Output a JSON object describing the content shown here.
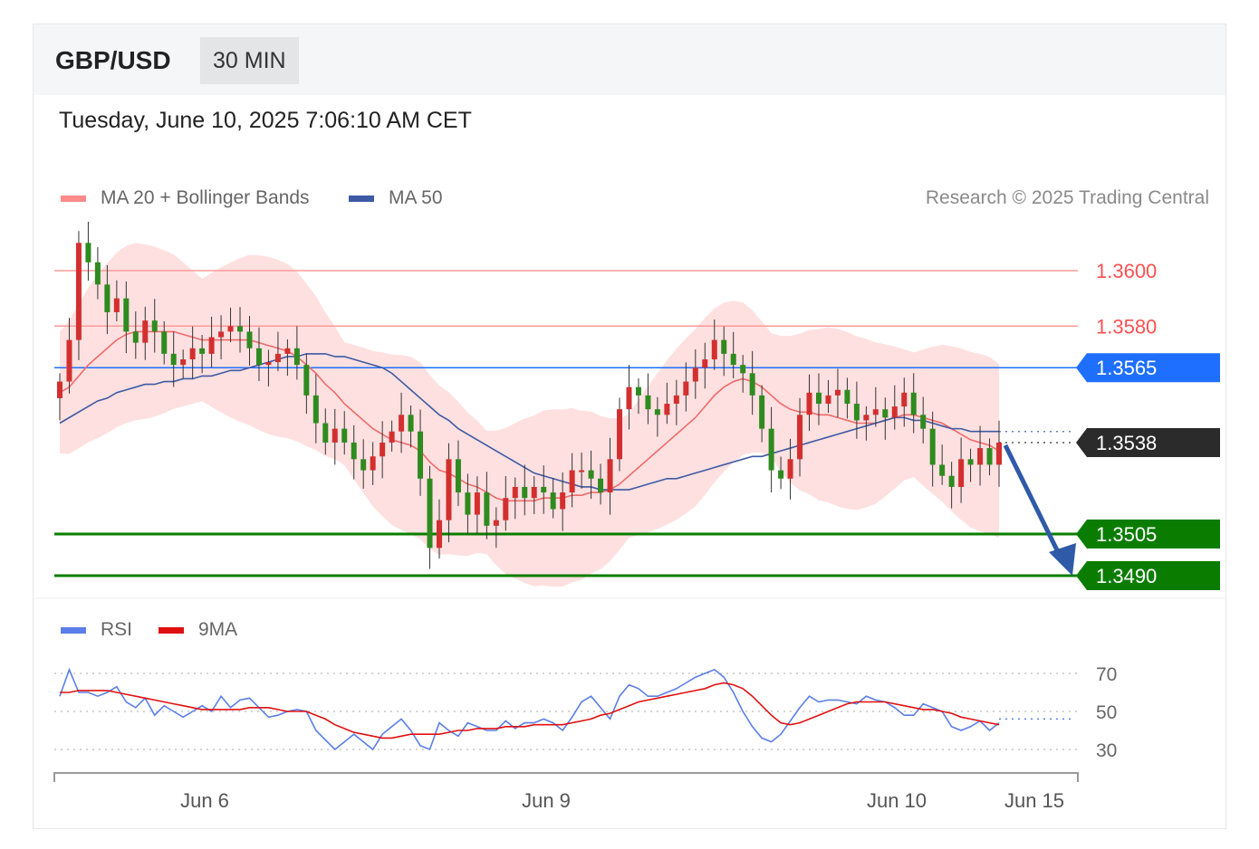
{
  "header": {
    "pair": "GBP/USD",
    "timeframe": "30 MIN"
  },
  "datetime": "Tuesday, June 10, 2025 7:06:10 AM CET",
  "legend": {
    "ma20_bb": "MA 20 + Bollinger Bands",
    "ma50": "MA 50",
    "rsi": "RSI",
    "rsi_ma": "9MA"
  },
  "credit": "Research © 2025 Trading Central",
  "colors": {
    "bull": "#2e8b1f",
    "bear": "#d32f2f",
    "band": "#ffd6d6",
    "ma20": "#f06a6a",
    "ma50": "#3d5aa3",
    "resistance": "#ff5050",
    "pivot": "#1e6fff",
    "support": "#0a7d00",
    "current": "#2b2b2b",
    "arrow": "#2e5aa8",
    "rsi": "#5b7fe8"
  },
  "chart_data": [
    {
      "type": "candlestick",
      "x_ticks": [
        "Jun 6",
        "Jun 9",
        "Jun 10",
        "Jun 15"
      ],
      "ylim": [
        1.348,
        1.362
      ],
      "levels": [
        {
          "label": "1.3600",
          "value": 1.36,
          "kind": "resistance"
        },
        {
          "label": "1.3580",
          "value": 1.358,
          "kind": "resistance"
        },
        {
          "label": "1.3565",
          "value": 1.3565,
          "kind": "pivot"
        },
        {
          "label": "1.3538",
          "value": 1.3538,
          "kind": "current"
        },
        {
          "label": "1.3505",
          "value": 1.3505,
          "kind": "support"
        },
        {
          "label": "1.3490",
          "value": 1.349,
          "kind": "support"
        }
      ],
      "close_path": [
        1.356,
        1.3575,
        1.361,
        1.3603,
        1.3595,
        1.3585,
        1.359,
        1.3578,
        1.3574,
        1.3582,
        1.3578,
        1.357,
        1.3566,
        1.3568,
        1.3572,
        1.357,
        1.3576,
        1.3578,
        1.358,
        1.3578,
        1.3572,
        1.3566,
        1.3567,
        1.357,
        1.3572,
        1.3566,
        1.3555,
        1.3545,
        1.3538,
        1.3543,
        1.3538,
        1.3532,
        1.3528,
        1.3533,
        1.3538,
        1.3542,
        1.3548,
        1.3542,
        1.3525,
        1.35,
        1.351,
        1.3532,
        1.352,
        1.3512,
        1.352,
        1.3508,
        1.351,
        1.3518,
        1.3522,
        1.3518,
        1.3522,
        1.352,
        1.3514,
        1.352,
        1.3528,
        1.3528,
        1.3525,
        1.352,
        1.3532,
        1.355,
        1.3558,
        1.3555,
        1.355,
        1.3548,
        1.3552,
        1.3555,
        1.356,
        1.3565,
        1.3568,
        1.3575,
        1.357,
        1.3566,
        1.3563,
        1.3555,
        1.3543,
        1.3528,
        1.3525,
        1.3532,
        1.3548,
        1.3556,
        1.3552,
        1.3555,
        1.3557,
        1.3552,
        1.3546,
        1.3548,
        1.355,
        1.3547,
        1.3551,
        1.3556,
        1.3548,
        1.3543,
        1.353,
        1.3526,
        1.3522,
        1.3532,
        1.353,
        1.3536,
        1.353,
        1.3538
      ],
      "ma20": [
        1.3556,
        1.3558,
        1.3562,
        1.3566,
        1.3569,
        1.3572,
        1.3575,
        1.3577,
        1.3578,
        1.3578,
        1.3578,
        1.3578,
        1.3578,
        1.3577,
        1.3576,
        1.3575,
        1.3575,
        1.3575,
        1.3575,
        1.3575,
        1.3575,
        1.3574,
        1.3573,
        1.3572,
        1.3571,
        1.3569,
        1.3566,
        1.3563,
        1.3559,
        1.3556,
        1.3552,
        1.3549,
        1.3546,
        1.3543,
        1.3541,
        1.3539,
        1.3538,
        1.3537,
        1.3535,
        1.3531,
        1.3528,
        1.3527,
        1.3525,
        1.3523,
        1.3522,
        1.352,
        1.3518,
        1.3517,
        1.3517,
        1.3517,
        1.3517,
        1.3518,
        1.3518,
        1.3518,
        1.3519,
        1.3519,
        1.352,
        1.352,
        1.3521,
        1.3523,
        1.3526,
        1.3529,
        1.3532,
        1.3535,
        1.3538,
        1.3541,
        1.3544,
        1.3547,
        1.3551,
        1.3555,
        1.3558,
        1.356,
        1.3561,
        1.356,
        1.3558,
        1.3555,
        1.3552,
        1.355,
        1.3549,
        1.3549,
        1.3548,
        1.3548,
        1.3547,
        1.3546,
        1.3545,
        1.3545,
        1.3545,
        1.3546,
        1.3547,
        1.3548,
        1.3548,
        1.3547,
        1.3546,
        1.3545,
        1.3543,
        1.3541,
        1.3539,
        1.3538,
        1.3537,
        1.3535
      ],
      "ma50": [
        1.3545,
        1.3547,
        1.3549,
        1.3551,
        1.3553,
        1.3554,
        1.3556,
        1.3557,
        1.3558,
        1.3559,
        1.3559,
        1.356,
        1.356,
        1.3561,
        1.3561,
        1.3562,
        1.3562,
        1.3563,
        1.3564,
        1.3564,
        1.3565,
        1.3566,
        1.3567,
        1.3568,
        1.3569,
        1.3569,
        1.357,
        1.357,
        1.357,
        1.3569,
        1.3569,
        1.3568,
        1.3567,
        1.3566,
        1.3565,
        1.3563,
        1.356,
        1.3557,
        1.3554,
        1.3551,
        1.3548,
        1.3546,
        1.3543,
        1.3541,
        1.3539,
        1.3537,
        1.3535,
        1.3533,
        1.3531,
        1.3529,
        1.3527,
        1.3526,
        1.3525,
        1.3524,
        1.3523,
        1.3522,
        1.3522,
        1.3521,
        1.3521,
        1.3521,
        1.3521,
        1.3522,
        1.3523,
        1.3524,
        1.3525,
        1.3525,
        1.3526,
        1.3527,
        1.3528,
        1.3529,
        1.353,
        1.3531,
        1.3532,
        1.3533,
        1.3533,
        1.3534,
        1.3535,
        1.3536,
        1.3537,
        1.3538,
        1.3539,
        1.354,
        1.3541,
        1.3542,
        1.3543,
        1.3544,
        1.3545,
        1.3546,
        1.3547,
        1.3547,
        1.3546,
        1.3546,
        1.3545,
        1.3544,
        1.3543,
        1.3543,
        1.3542,
        1.3542,
        1.3542,
        1.3542
      ]
    },
    {
      "type": "line",
      "name": "RSI",
      "ylim": [
        25,
        80
      ],
      "ticks": [
        "70",
        "50",
        "30"
      ],
      "tick_values": [
        70,
        50,
        30
      ],
      "rsi": [
        58,
        72,
        60,
        60,
        58,
        60,
        63,
        55,
        52,
        57,
        48,
        53,
        50,
        47,
        50,
        53,
        50,
        58,
        52,
        56,
        57,
        52,
        47,
        48,
        50,
        51,
        50,
        40,
        35,
        30,
        34,
        38,
        34,
        30,
        38,
        42,
        46,
        40,
        32,
        30,
        44,
        40,
        37,
        44,
        42,
        40,
        40,
        45,
        41,
        44,
        44,
        46,
        44,
        40,
        47,
        55,
        58,
        52,
        46,
        58,
        64,
        62,
        58,
        58,
        60,
        62,
        65,
        68,
        70,
        72,
        68,
        60,
        50,
        42,
        36,
        34,
        38,
        45,
        52,
        58,
        55,
        56,
        56,
        55,
        54,
        58,
        56,
        55,
        52,
        48,
        48,
        54,
        52,
        50,
        42,
        40,
        42,
        45,
        40,
        44
      ],
      "rsi_ma": [
        60,
        60,
        61,
        61,
        61,
        61,
        60,
        59,
        58,
        57,
        56,
        55,
        54,
        53,
        52,
        51,
        51,
        51,
        51,
        51,
        52,
        52,
        52,
        51,
        50,
        50,
        50,
        48,
        46,
        43,
        41,
        39,
        38,
        37,
        36,
        36,
        37,
        38,
        38,
        38,
        38,
        39,
        40,
        40,
        41,
        41,
        41,
        42,
        42,
        42,
        43,
        43,
        43,
        43,
        44,
        45,
        46,
        48,
        49,
        51,
        53,
        55,
        56,
        57,
        58,
        59,
        60,
        61,
        62,
        64,
        65,
        64,
        62,
        58,
        53,
        48,
        44,
        43,
        44,
        46,
        48,
        50,
        52,
        54,
        55,
        55,
        55,
        55,
        54,
        53,
        52,
        51,
        51,
        50,
        49,
        47,
        46,
        45,
        44,
        43
      ]
    }
  ]
}
